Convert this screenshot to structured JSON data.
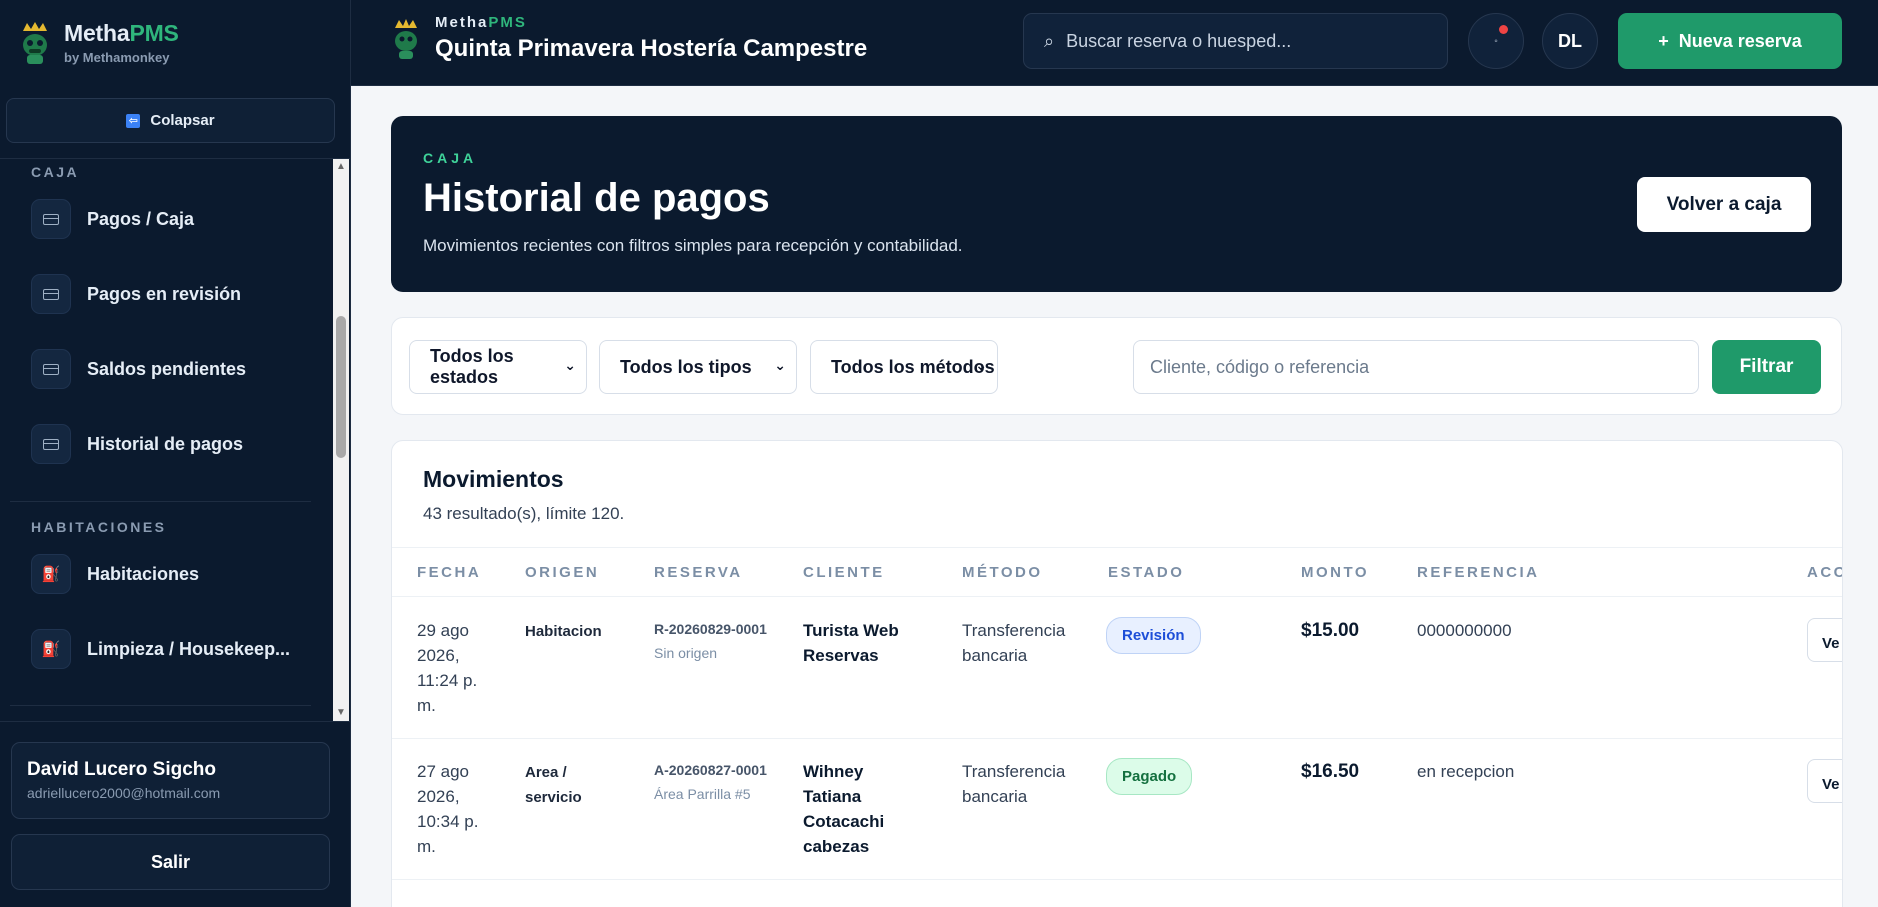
{
  "brand": {
    "name_main": "Metha",
    "name_accent": "PMS",
    "byline": "by Methamonkey"
  },
  "sidebar": {
    "collapse_label": "Colapsar",
    "sections": [
      {
        "title": "CAJA",
        "items": [
          {
            "label": "Pagos / Caja",
            "icon": "card-icon"
          },
          {
            "label": "Pagos en revisión",
            "icon": "card-icon"
          },
          {
            "label": "Saldos pendientes",
            "icon": "card-icon"
          },
          {
            "label": "Historial de pagos",
            "icon": "card-icon"
          }
        ]
      },
      {
        "title": "HABITACIONES",
        "items": [
          {
            "label": "Habitaciones",
            "icon": "bed-icon"
          },
          {
            "label": "Limpieza / Housekeep...",
            "icon": "bed-icon"
          }
        ]
      }
    ],
    "user": {
      "name": "David Lucero Sigcho",
      "email": "adriellucero2000@hotmail.com"
    },
    "logout_label": "Salir"
  },
  "topbar": {
    "brand_small_main": "Metha",
    "brand_small_accent": "PMS",
    "property_name": "Quinta Primavera Hostería Campestre",
    "search_placeholder": "Buscar reserva o huesped...",
    "avatar_initials": "DL",
    "new_booking_label": "Nueva reserva"
  },
  "hero": {
    "kicker": "CAJA",
    "title": "Historial de pagos",
    "subtitle": "Movimientos recientes con filtros simples para recepción y contabilidad.",
    "back_label": "Volver a caja"
  },
  "filters": {
    "status": "Todos los estados",
    "type": "Todos los tipos",
    "method": "Todos los métodos",
    "search_placeholder": "Cliente, código o referencia",
    "submit_label": "Filtrar"
  },
  "movements": {
    "title": "Movimientos",
    "summary": "43 resultado(s), límite 120.",
    "columns": [
      "FECHA",
      "ORIGEN",
      "RESERVA",
      "CLIENTE",
      "MÉTODO",
      "ESTADO",
      "MONTO",
      "REFERENCIA",
      "ACC"
    ],
    "rows": [
      {
        "fecha": "29 ago 2026, 11:24 p. m.",
        "origen": "Habitacion",
        "reserva": "R-20260829-0001",
        "reserva_origen": "Sin origen",
        "cliente": "Turista Web Reservas",
        "metodo": "Transferencia bancaria",
        "estado": "Revisión",
        "monto": "$15.00",
        "referencia": "0000000000",
        "accion": "Ve"
      },
      {
        "fecha": "27 ago 2026, 10:34 p. m.",
        "origen": "Area / servicio",
        "reserva": "A-20260827-0001",
        "reserva_origen": "Área Parrilla #5",
        "cliente": "Wihney Tatiana Cotacachi cabezas",
        "metodo": "Transferencia bancaria",
        "estado": "Pagado",
        "monto": "$16.50",
        "referencia": "en recepcion",
        "accion": "Ve"
      }
    ]
  },
  "colors": {
    "navy": "#0b1a2e",
    "green": "#1f9a6a",
    "accent_green": "#2fb67c"
  }
}
